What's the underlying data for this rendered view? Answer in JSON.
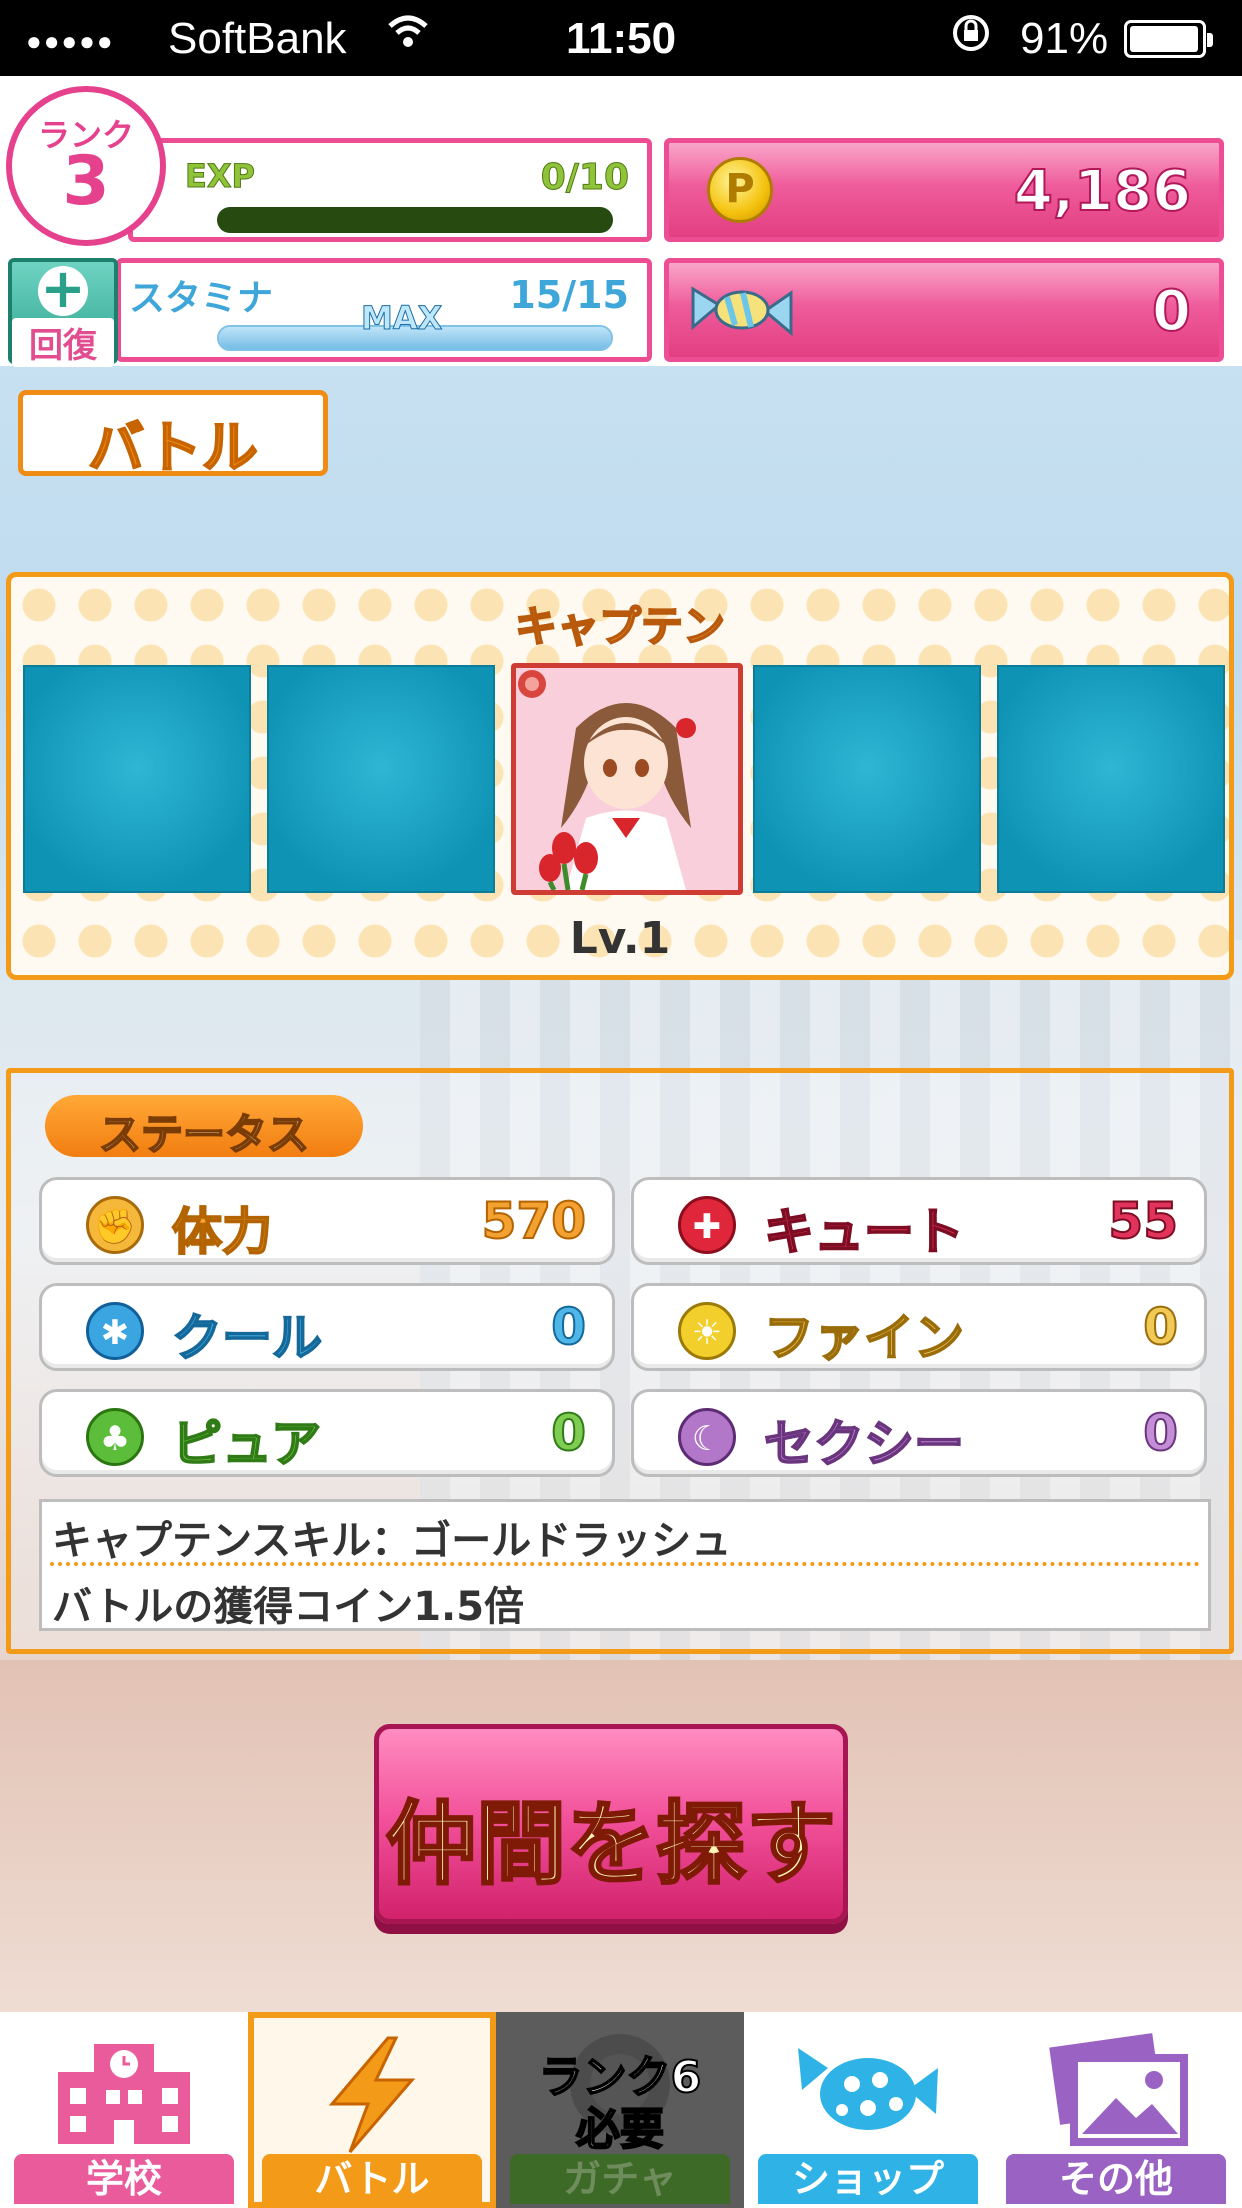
{
  "status_bar": {
    "signal": "●●●●●",
    "carrier": "SoftBank",
    "time": "11:50",
    "battery": "91%"
  },
  "player": {
    "rank_label": "ランク",
    "rank": "3",
    "exp_label": "EXP",
    "exp_value": "0/10",
    "exp_progress": 0.0,
    "recover_label": "回復",
    "stamina_label": "スタミナ",
    "stamina_max_badge": "MAX",
    "stamina_value": "15/15",
    "stamina_progress": 1.0,
    "coins": "4,186",
    "candy": "0"
  },
  "page_title": "バトル",
  "team": {
    "captain_label": "キャプテン",
    "captain_level": "Lv.1"
  },
  "status": {
    "tab_label": "ステータス",
    "stats": [
      {
        "name": "体力",
        "value": "570"
      },
      {
        "name": "キュート",
        "value": "55"
      },
      {
        "name": "クール",
        "value": "0"
      },
      {
        "name": "ファイン",
        "value": "0"
      },
      {
        "name": "ピュア",
        "value": "0"
      },
      {
        "name": "セクシー",
        "value": "0"
      }
    ],
    "skill_title": "キャプテンスキル：ゴールドラッシュ",
    "skill_desc": "バトルの獲得コイン1.5倍"
  },
  "find_button": "仲間を探す",
  "nav": {
    "school": "学校",
    "battle": "バトル",
    "gacha": "ガチャ",
    "gacha_lock_line1": "ランク6",
    "gacha_lock_line2": "必要",
    "shop": "ショップ",
    "other": "その他"
  },
  "colors": {
    "pink": "#ec4d93",
    "orange": "#f39a18",
    "teal": "#0f93b5"
  }
}
